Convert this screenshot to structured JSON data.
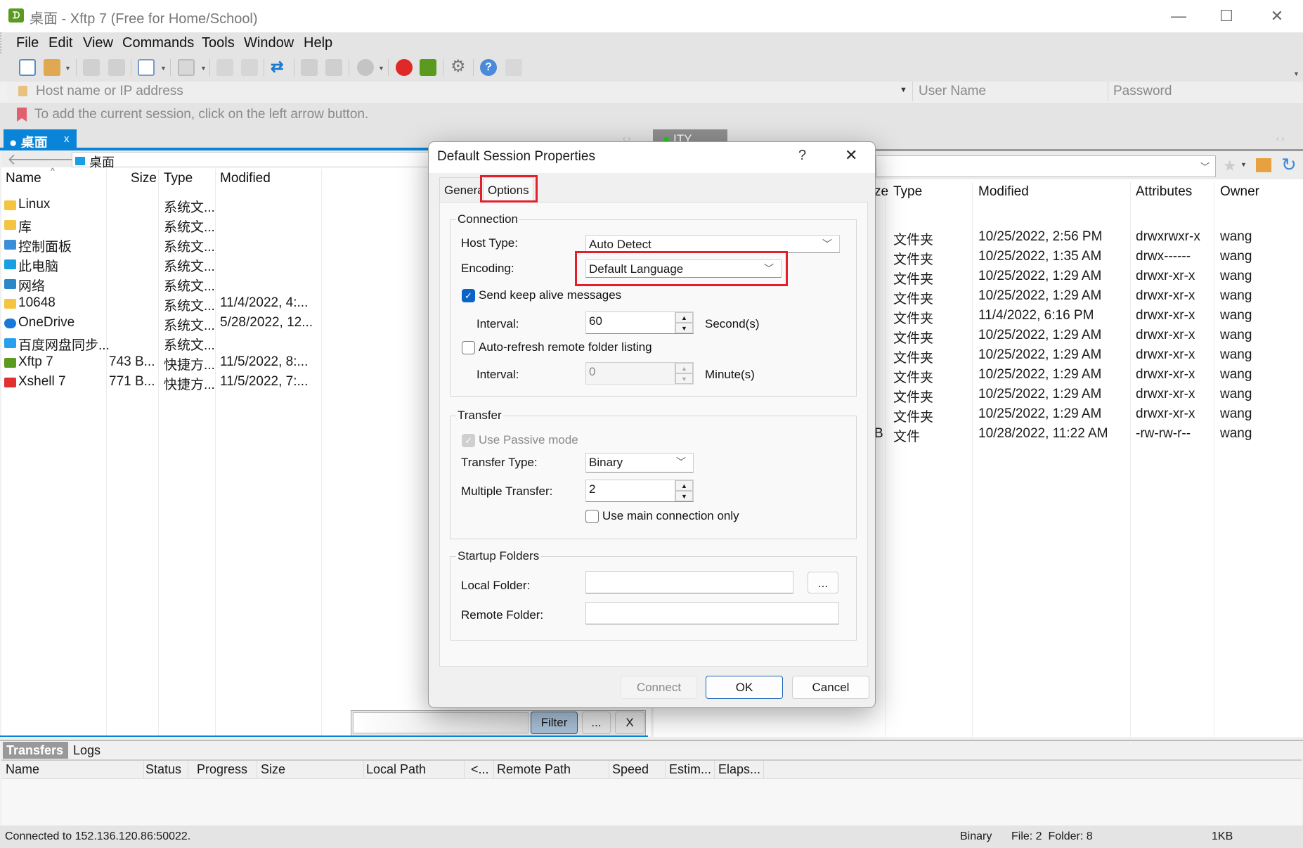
{
  "window": {
    "title": "桌面 - Xftp 7 (Free for Home/School)",
    "app_icon": "xftp-logo-icon",
    "minimize": "—",
    "maximize": "☐",
    "close": "✕"
  },
  "menu": [
    "File",
    "Edit",
    "View",
    "Commands",
    "Tools",
    "Window",
    "Help"
  ],
  "toolbar": [
    "new-session-icon",
    "open-folder-icon",
    "disconnect-icon",
    "reconnect-icon",
    "new-tab-icon",
    "play-icon",
    "upload-icon",
    "download-icon",
    "sync-icon",
    "copy-icon",
    "paste-icon",
    "globe-icon",
    "xshell-icon",
    "xftp-icon",
    "settings-icon",
    "help-icon",
    "chat-icon"
  ],
  "address": {
    "host_placeholder": "Host name or IP address",
    "user_placeholder": "User Name",
    "password_placeholder": "Password"
  },
  "hint": "To add the current session, click on the left arrow button.",
  "local": {
    "tab": "桌面",
    "tab_close": "x",
    "path": "桌面",
    "columns": [
      "Name",
      "Size",
      "Type",
      "Modified"
    ],
    "rows": [
      {
        "name": "Linux",
        "size": "",
        "type": "系统文...",
        "modified": "",
        "icon": "folder",
        "color": "#f5c542"
      },
      {
        "name": "库",
        "size": "",
        "type": "系统文...",
        "modified": "",
        "icon": "folder",
        "color": "#f5c542"
      },
      {
        "name": "控制面板",
        "size": "",
        "type": "系统文...",
        "modified": "",
        "icon": "control-panel",
        "color": "#3a8fd8"
      },
      {
        "name": "此电脑",
        "size": "",
        "type": "系统文...",
        "modified": "",
        "icon": "computer",
        "color": "#1aa0e0"
      },
      {
        "name": "网络",
        "size": "",
        "type": "系统文...",
        "modified": "",
        "icon": "network",
        "color": "#2a88c8"
      },
      {
        "name": "10648",
        "size": "",
        "type": "系统文...",
        "modified": "11/4/2022, 4:...",
        "icon": "folder",
        "color": "#f5c542"
      },
      {
        "name": "OneDrive",
        "size": "",
        "type": "系统文...",
        "modified": "5/28/2022, 12...",
        "icon": "cloud",
        "color": "#1a78d8"
      },
      {
        "name": "百度网盘同步...",
        "size": "",
        "type": "系统文...",
        "modified": "",
        "icon": "baidu",
        "color": "#2a9ff0"
      },
      {
        "name": "Xftp 7",
        "size": "743 B...",
        "type": "快捷方...",
        "modified": "11/5/2022, 8:...",
        "icon": "xftp-shortcut",
        "color": "#5a9a1e"
      },
      {
        "name": "Xshell 7",
        "size": "771 B...",
        "type": "快捷方...",
        "modified": "11/5/2022, 7:...",
        "icon": "xshell-shortcut",
        "color": "#e03030"
      }
    ]
  },
  "remote": {
    "tab": "ITY",
    "columns": [
      "ze",
      "Type",
      "Modified",
      "Attributes",
      "Owner"
    ],
    "rows": [
      {
        "size": "",
        "type": "文件夹",
        "modified": "10/25/2022, 2:56 PM",
        "attributes": "drwxrwxr-x",
        "owner": "wang"
      },
      {
        "size": "",
        "type": "文件夹",
        "modified": "10/25/2022, 1:35 AM",
        "attributes": "drwx------",
        "owner": "wang"
      },
      {
        "size": "",
        "type": "文件夹",
        "modified": "10/25/2022, 1:29 AM",
        "attributes": "drwxr-xr-x",
        "owner": "wang"
      },
      {
        "size": "",
        "type": "文件夹",
        "modified": "10/25/2022, 1:29 AM",
        "attributes": "drwxr-xr-x",
        "owner": "wang"
      },
      {
        "size": "",
        "type": "文件夹",
        "modified": "11/4/2022, 6:16 PM",
        "attributes": "drwxr-xr-x",
        "owner": "wang"
      },
      {
        "size": "",
        "type": "文件夹",
        "modified": "10/25/2022, 1:29 AM",
        "attributes": "drwxr-xr-x",
        "owner": "wang"
      },
      {
        "size": "",
        "type": "文件夹",
        "modified": "10/25/2022, 1:29 AM",
        "attributes": "drwxr-xr-x",
        "owner": "wang"
      },
      {
        "size": "",
        "type": "文件夹",
        "modified": "10/25/2022, 1:29 AM",
        "attributes": "drwxr-xr-x",
        "owner": "wang"
      },
      {
        "size": "",
        "type": "文件夹",
        "modified": "10/25/2022, 1:29 AM",
        "attributes": "drwxr-xr-x",
        "owner": "wang"
      },
      {
        "size": "",
        "type": "文件夹",
        "modified": "10/25/2022, 1:29 AM",
        "attributes": "drwxr-xr-x",
        "owner": "wang"
      },
      {
        "size": "B",
        "type": "文件",
        "modified": "10/28/2022, 11:22 AM",
        "attributes": "-rw-rw-r--",
        "owner": "wang"
      }
    ]
  },
  "filter": {
    "button": "Filter",
    "more": "...",
    "clear": "X"
  },
  "dialog": {
    "title": "Default Session Properties",
    "help": "?",
    "close": "✕",
    "tabs": [
      "Genera",
      "Options"
    ],
    "active_tab": "Options",
    "connection": {
      "label": "Connection",
      "host_type_label": "Host Type:",
      "host_type": "Auto Detect",
      "encoding_label": "Encoding:",
      "encoding": "Default Language",
      "keep_alive_label": "Send keep alive messages",
      "keep_alive": true,
      "interval_label": "Interval:",
      "interval": "60",
      "interval_unit": "Second(s)",
      "auto_refresh_label": "Auto-refresh remote folder listing",
      "auto_refresh": false,
      "refresh_interval_label": "Interval:",
      "refresh_interval": "0",
      "refresh_unit": "Minute(s)"
    },
    "transfer": {
      "label": "Transfer",
      "passive_label": "Use Passive mode",
      "passive": true,
      "type_label": "Transfer Type:",
      "type": "Binary",
      "multiple_label": "Multiple Transfer:",
      "multiple": "2",
      "main_only_label": "Use main connection only",
      "main_only": false
    },
    "startup": {
      "label": "Startup Folders",
      "local_label": "Local Folder:",
      "local": "",
      "browse": "...",
      "remote_label": "Remote Folder:",
      "remote": ""
    },
    "buttons": {
      "connect": "Connect",
      "ok": "OK",
      "cancel": "Cancel"
    },
    "highlight_color": "#e21f2b"
  },
  "bottom": {
    "tabs": [
      "Transfers",
      "Logs"
    ],
    "columns": [
      "Name",
      "Status",
      "Progress",
      "Size",
      "Local Path",
      "<...",
      "Remote Path",
      "Speed",
      "Estim...",
      "Elaps..."
    ]
  },
  "status": {
    "connection": "Connected to 152.136.120.86:50022.",
    "mode": "Binary",
    "counts": "File: 2  Folder: 8",
    "size": "1KB"
  }
}
